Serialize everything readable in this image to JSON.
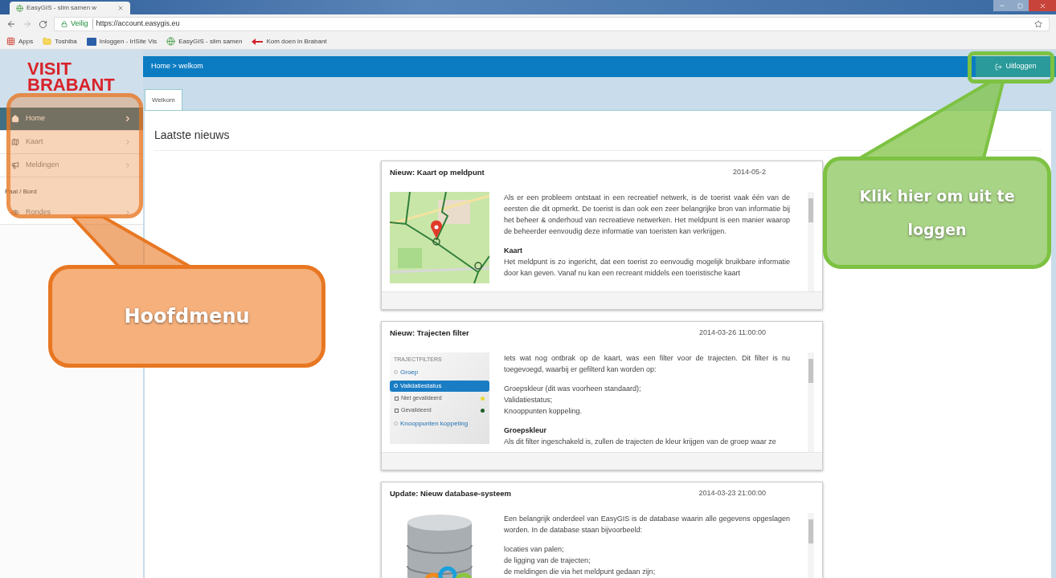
{
  "browser": {
    "tab_title": "EasyGIS - slim samen w",
    "security": "Veilig",
    "url": "https://account.easygis.eu",
    "bookmarks": [
      {
        "label": "Apps",
        "kind": "apps"
      },
      {
        "label": "Toshiba",
        "kind": "folder"
      },
      {
        "label": "Inloggen - IriSite Vis",
        "kind": "site"
      },
      {
        "label": "EasyGIS - slim samen",
        "kind": "globe"
      },
      {
        "label": "Kom doen in Brabant",
        "kind": "arrow"
      }
    ]
  },
  "logo": [
    "VISIT",
    "BRABANT"
  ],
  "breadcrumb": "Home > welkom",
  "logout": "Uitloggen",
  "sidebar": {
    "items": [
      {
        "kind": "item",
        "label": "Home",
        "selected": true
      },
      {
        "kind": "item",
        "label": "Kaart",
        "selected": false
      },
      {
        "kind": "item",
        "label": "Meldingen",
        "selected": false
      },
      {
        "kind": "section",
        "label": "Paal / Bord"
      },
      {
        "kind": "item",
        "label": "Rondes",
        "selected": false
      }
    ]
  },
  "tabs": [
    {
      "label": "Welkom",
      "selected": true
    }
  ],
  "heading": "Laatste nieuws",
  "news": [
    {
      "title": "Nieuw: Kaart op meldpunt",
      "date": "2014-05-2",
      "blocks": [
        {
          "kind": "text",
          "text": "Als er een probleem ontstaat in een recreatief netwerk, is de toerist vaak één van de eersten die dit opmerkt. De toerist is dan ook een zeer belangrijke bron van informatie bij het beheer & onderhoud van recreatieve netwerken. Het meldpunt is een manier waarop de beheerder eenvoudig deze informatie van toeristen kan verkrijgen."
        },
        {
          "kind": "heading",
          "text": "Kaart"
        },
        {
          "kind": "text",
          "text": "Het meldpunt is zo ingericht, dat een toerist zo eenvoudig mogelijk bruikbare informatie door kan geven. Vanaf nu kan een recreant middels een toeristische kaart"
        }
      ]
    },
    {
      "title": "Nieuw: Trajecten filter",
      "date": "2014-03-26 11:00:00",
      "blocks": [
        {
          "kind": "text",
          "text": "Iets wat nog ontbrak op de kaart, was een filter voor de trajecten. Dit filter is nu toegevoegd, waarbij er gefilterd kan worden op:"
        },
        {
          "kind": "list",
          "items": [
            "Groepskleur (dit was voorheen standaard);",
            "Validatiestatus;",
            "Knooppunten koppeling."
          ]
        },
        {
          "kind": "heading",
          "text": "Groepskleur"
        },
        {
          "kind": "text",
          "text": "Als dit filter ingeschakeld is, zullen de trajecten de kleur krijgen van de groep waar ze"
        }
      ]
    },
    {
      "title": "Update: Nieuw database-systeem",
      "date": "2014-03-23 21:00:00",
      "blocks": [
        {
          "kind": "text",
          "text": "Een belangrijk onderdeel van EasyGIS is de database waarin alle gegevens opgeslagen worden. In de database staan bijvoorbeeld:"
        },
        {
          "kind": "list",
          "items": [
            "locaties van palen;",
            "de ligging van de trajecten;",
            "de meldingen die via het meldpunt gedaan zijn;"
          ]
        }
      ]
    }
  ],
  "filter_panel": {
    "title": "TRAJECTFILTERS",
    "options": [
      {
        "label": "Groep",
        "selected": false
      },
      {
        "label": "Validatiestatus",
        "selected": true,
        "children": [
          {
            "label": "Niet gevalideerd",
            "color": "#e8d83a"
          },
          {
            "label": "Gevalideerd",
            "color": "#1f5f2a"
          }
        ]
      },
      {
        "label": "Knooppunten koppeling",
        "selected": false
      }
    ]
  },
  "callouts": [
    {
      "text": "Hoofdmenu",
      "color": "#e87722"
    },
    {
      "text": "Klik hier om uit te loggen",
      "color": "#7dc242"
    }
  ]
}
